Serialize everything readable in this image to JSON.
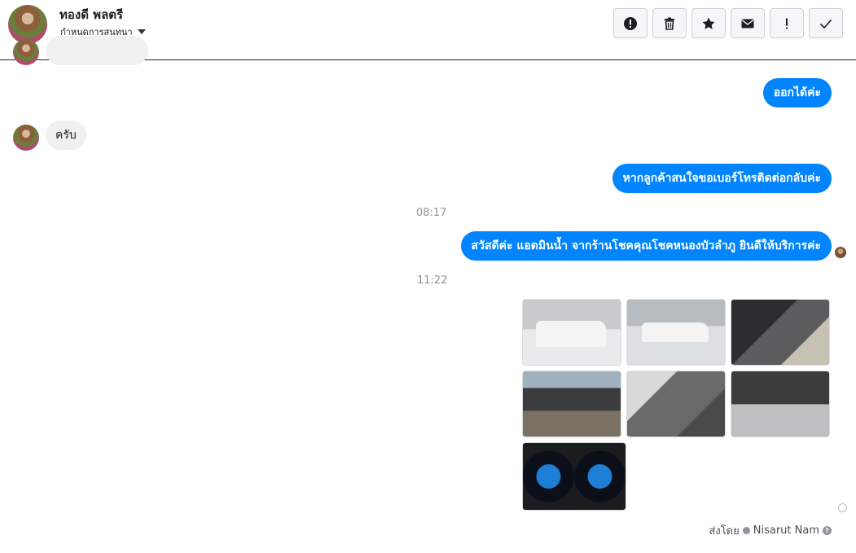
{
  "header": {
    "contact_name": "ทองดี พลตรี",
    "subtitle": "กำหนดการสนทนา",
    "tools": [
      {
        "icon": "alert-circle-icon"
      },
      {
        "icon": "trash-icon"
      },
      {
        "icon": "star-icon"
      },
      {
        "icon": "envelope-icon"
      },
      {
        "icon": "exclamation-icon"
      },
      {
        "icon": "check-icon"
      }
    ]
  },
  "messages": [
    {
      "from": "page",
      "text": "ออกได้ค่ะ"
    },
    {
      "from": "customer",
      "text": "ครับ"
    },
    {
      "from": "page",
      "text": "หากลูกค้าสนใจขอเบอร์โทรติดต่อกลับค่ะ"
    },
    {
      "time": "08:17"
    },
    {
      "from": "page",
      "text": "สวัสดีค่ะ แอดมินน้ำ จากร้านโชคคุณโชคหนองบัวลำภู ยินดีให้บริการค่ะ"
    },
    {
      "time": "11:22"
    },
    {
      "from": "page",
      "type": "images",
      "count": 7
    }
  ],
  "footer": {
    "sent_by_label": "ส่งโดย",
    "sender_name": "Nisarut Nam"
  },
  "colors": {
    "accent": "#0084ff",
    "incoming_bubble": "#f1f0f0",
    "timestamp": "#90949c"
  }
}
